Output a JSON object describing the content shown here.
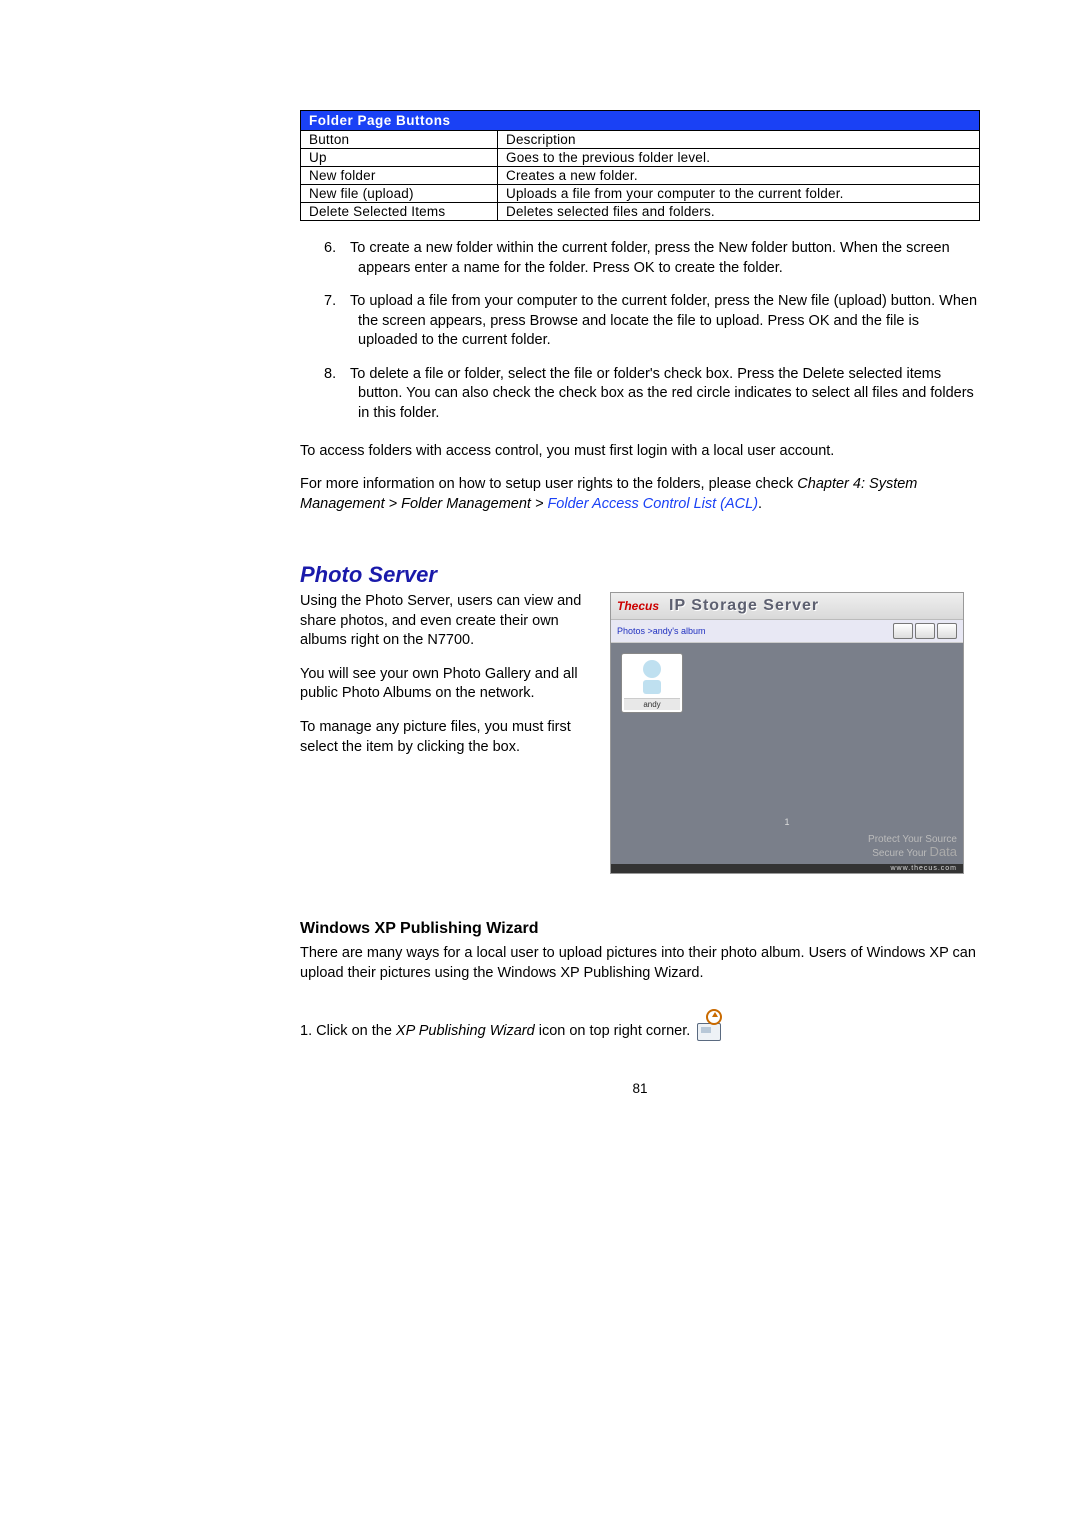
{
  "table": {
    "title": "Folder Page Buttons",
    "headers": [
      "Button",
      "Description"
    ],
    "rows": [
      {
        "button": "Up",
        "desc": "Goes to the previous folder level."
      },
      {
        "button": "New folder",
        "desc": "Creates a new folder."
      },
      {
        "button": "New file (upload)",
        "desc": "Uploads a file from your computer to the current folder."
      },
      {
        "button": "Delete Selected Items",
        "desc": "Deletes selected files and folders."
      }
    ]
  },
  "steps": {
    "s6": {
      "num": "6.",
      "text": "To create a new folder within the current folder, press the New folder button. When the screen appears enter a name for the folder. Press OK to create the folder."
    },
    "s7": {
      "num": "7.",
      "text": "To upload a file from your computer to the current folder, press the New file (upload) button. When the screen appears, press Browse and locate the file to upload. Press OK and the file is uploaded to the current folder."
    },
    "s8": {
      "num": "8.",
      "text": "To delete a file or folder, select the file or folder's check box. Press the Delete selected items button. You can also check the check box as the red circle indicates to select all files and folders in this folder."
    }
  },
  "para": {
    "access": "To access folders with access control, you must first login with a local user account.",
    "moreinfo": "For more information on how to setup user rights to the folders, please check ",
    "moreinfo_italic": "Chapter 4: System Management > Folder Management >",
    "acl_link": " Folder Access Control List (ACL)",
    "period": "."
  },
  "photo": {
    "heading": "Photo Server",
    "p1": "Using the Photo Server, users can view and share photos, and even create their own albums right on the N7700.",
    "p2": "You will see your own Photo Gallery and all public Photo Albums on the network.",
    "p3": "To manage any picture files, you must first select the item by clicking the box.",
    "screenshot": {
      "logo": "Thecus",
      "title": "IP Storage Server",
      "breadcrumb": "Photos >andy's album",
      "thumb_label": "andy",
      "pager": "1",
      "footer_line1": "Protect Your Source",
      "footer_line2": "Secure Your",
      "footer_data": "Data",
      "url": "www.thecus.com"
    }
  },
  "wizard": {
    "heading": "Windows XP Publishing Wizard",
    "intro": "There are many ways for a local user to upload pictures into their photo album. Users of Windows XP can upload their pictures using the Windows XP Publishing Wizard.",
    "step_num": "1.",
    "step_pre": "Click on the ",
    "step_em": "XP Publishing Wizard",
    "step_post": " icon on top right corner."
  },
  "page_number": "81"
}
